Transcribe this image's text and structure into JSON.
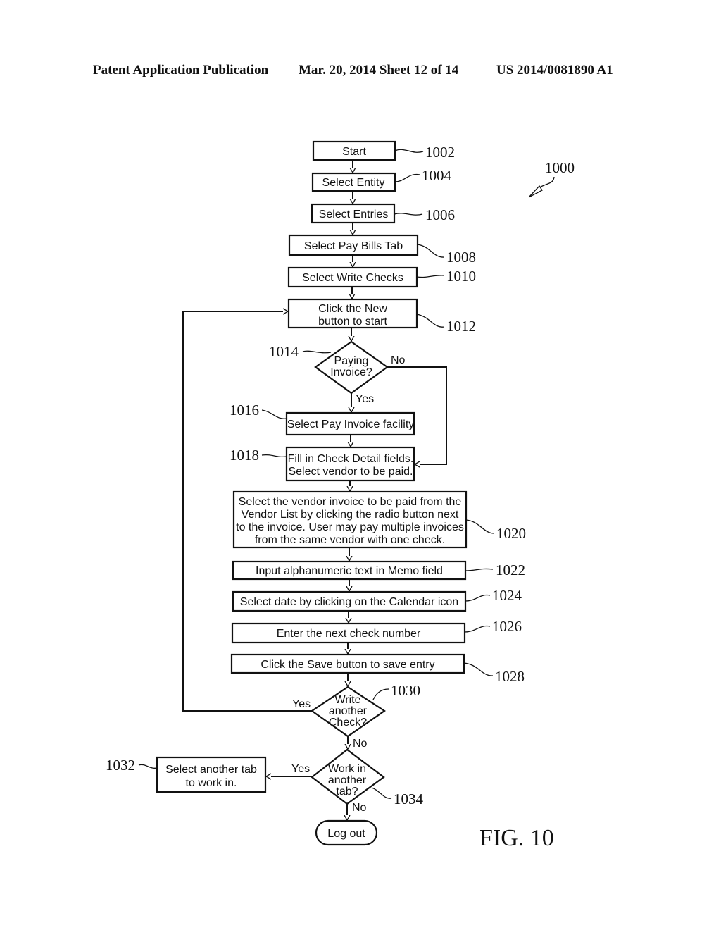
{
  "header": {
    "left": "Patent Application Publication",
    "middle": "Mar. 20, 2014  Sheet 12 of 14",
    "right": "US 2014/0081890 A1"
  },
  "figure": {
    "label": "FIG. 10",
    "ref": "1000"
  },
  "steps": [
    {
      "ref": "1002",
      "lines": [
        "Start"
      ]
    },
    {
      "ref": "1004",
      "lines": [
        "Select Entity"
      ]
    },
    {
      "ref": "1006",
      "lines": [
        "Select Entries"
      ]
    },
    {
      "ref": "1008",
      "lines": [
        "Select Pay Bills Tab"
      ]
    },
    {
      "ref": "1010",
      "lines": [
        "Select Write Checks"
      ]
    },
    {
      "ref": "1012",
      "lines": [
        "Click the New",
        "button to start"
      ]
    },
    {
      "ref": "1016",
      "lines": [
        "Select Pay Invoice facility"
      ]
    },
    {
      "ref": "1018",
      "lines": [
        "Fill in Check Detail fields.",
        "Select vendor to be paid."
      ]
    },
    {
      "ref": "1020",
      "lines": [
        "Select the vendor invoice to be paid from the",
        "Vendor List by clicking the radio button next",
        "to the invoice. User may pay multiple invoices",
        "from the same vendor with one check."
      ]
    },
    {
      "ref": "1022",
      "lines": [
        "Input alphanumeric text in Memo field"
      ]
    },
    {
      "ref": "1024",
      "lines": [
        "Select date by clicking on the Calendar icon"
      ]
    },
    {
      "ref": "1026",
      "lines": [
        "Enter the next check number"
      ]
    },
    {
      "ref": "1028",
      "lines": [
        "Click the Save button to save entry"
      ]
    },
    {
      "ref": "1032",
      "lines": [
        "Select another tab",
        "to work in."
      ]
    }
  ],
  "decisions": [
    {
      "ref": "1014",
      "lines": [
        "Paying",
        "Invoice?"
      ],
      "yes": "Yes",
      "no": "No"
    },
    {
      "ref": "1030",
      "lines": [
        "Write",
        "another",
        "Check?"
      ],
      "yes": "Yes",
      "no": "No"
    },
    {
      "ref": "1034",
      "lines": [
        "Work in",
        "another",
        "tab?"
      ],
      "yes": "Yes",
      "no": "No"
    }
  ],
  "terminal": {
    "label": "Log out"
  }
}
